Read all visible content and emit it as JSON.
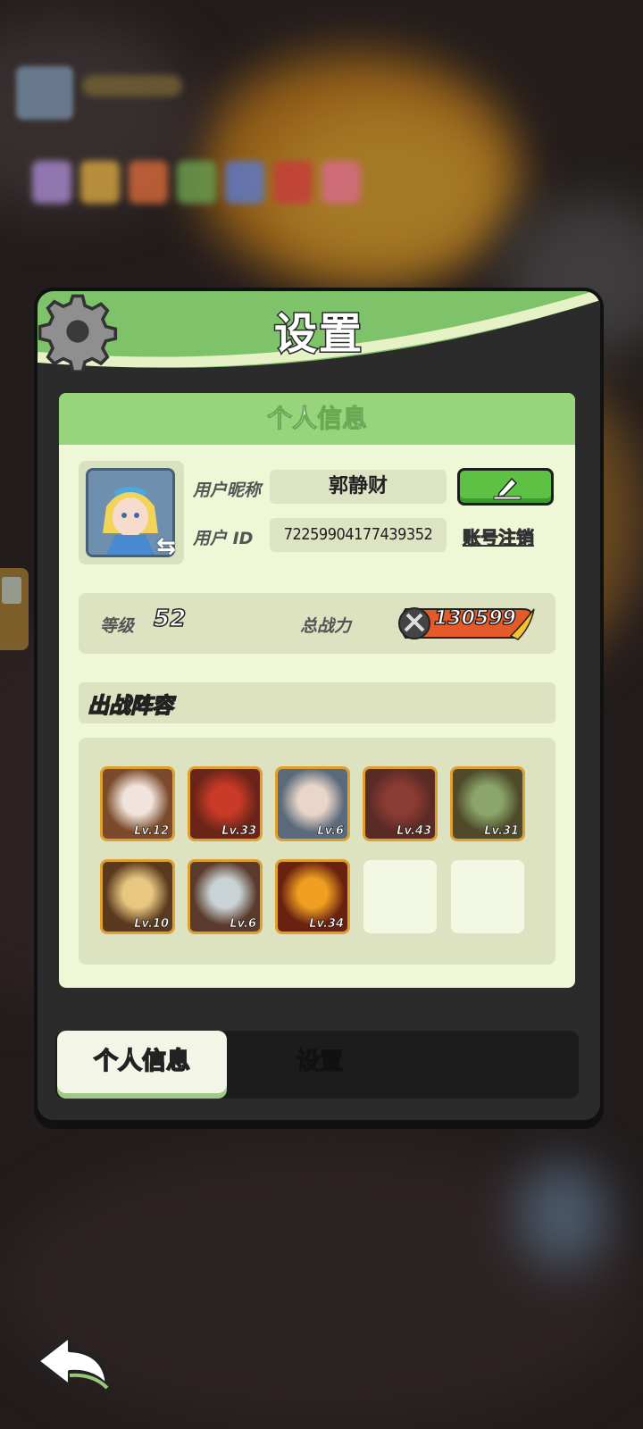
{
  "panel": {
    "title": "设置",
    "card_title": "个人信息"
  },
  "profile": {
    "nickname_label": "用户昵称",
    "nickname": "郭静财",
    "id_label": "用户 ID",
    "user_id": "72259904177439352",
    "cancel_account": "账号注销"
  },
  "stats": {
    "level_label": "等级",
    "level": "52",
    "power_label": "总战力",
    "power": "130599"
  },
  "lineup": {
    "title": "出战阵容",
    "heroes": [
      {
        "level": "Lv.12",
        "colors": [
          "#7a4a2a",
          "#f1e4dc"
        ]
      },
      {
        "level": "Lv.33",
        "colors": [
          "#6b2518",
          "#c93a28"
        ]
      },
      {
        "level": "Lv.6",
        "colors": [
          "#5a6a7a",
          "#e9d6c8"
        ]
      },
      {
        "level": "Lv.43",
        "colors": [
          "#5a2a24",
          "#8b3c34"
        ]
      },
      {
        "level": "Lv.31",
        "colors": [
          "#4f4a2a",
          "#8ba66a"
        ]
      },
      {
        "level": "Lv.10",
        "colors": [
          "#5a3a1e",
          "#e8c880"
        ]
      },
      {
        "level": "Lv.6",
        "colors": [
          "#5a3a2a",
          "#c9d3d6"
        ]
      },
      {
        "level": "Lv.34",
        "colors": [
          "#6a2210",
          "#f0a020"
        ]
      }
    ],
    "empty_slots": 2
  },
  "tabs": {
    "active": "个人信息",
    "inactive": "设置"
  },
  "colors": {
    "header_green": "#7ec26a",
    "card_bg": "#eef7d6",
    "edit_green": "#5dc244",
    "hero_border": "#e0a030"
  }
}
